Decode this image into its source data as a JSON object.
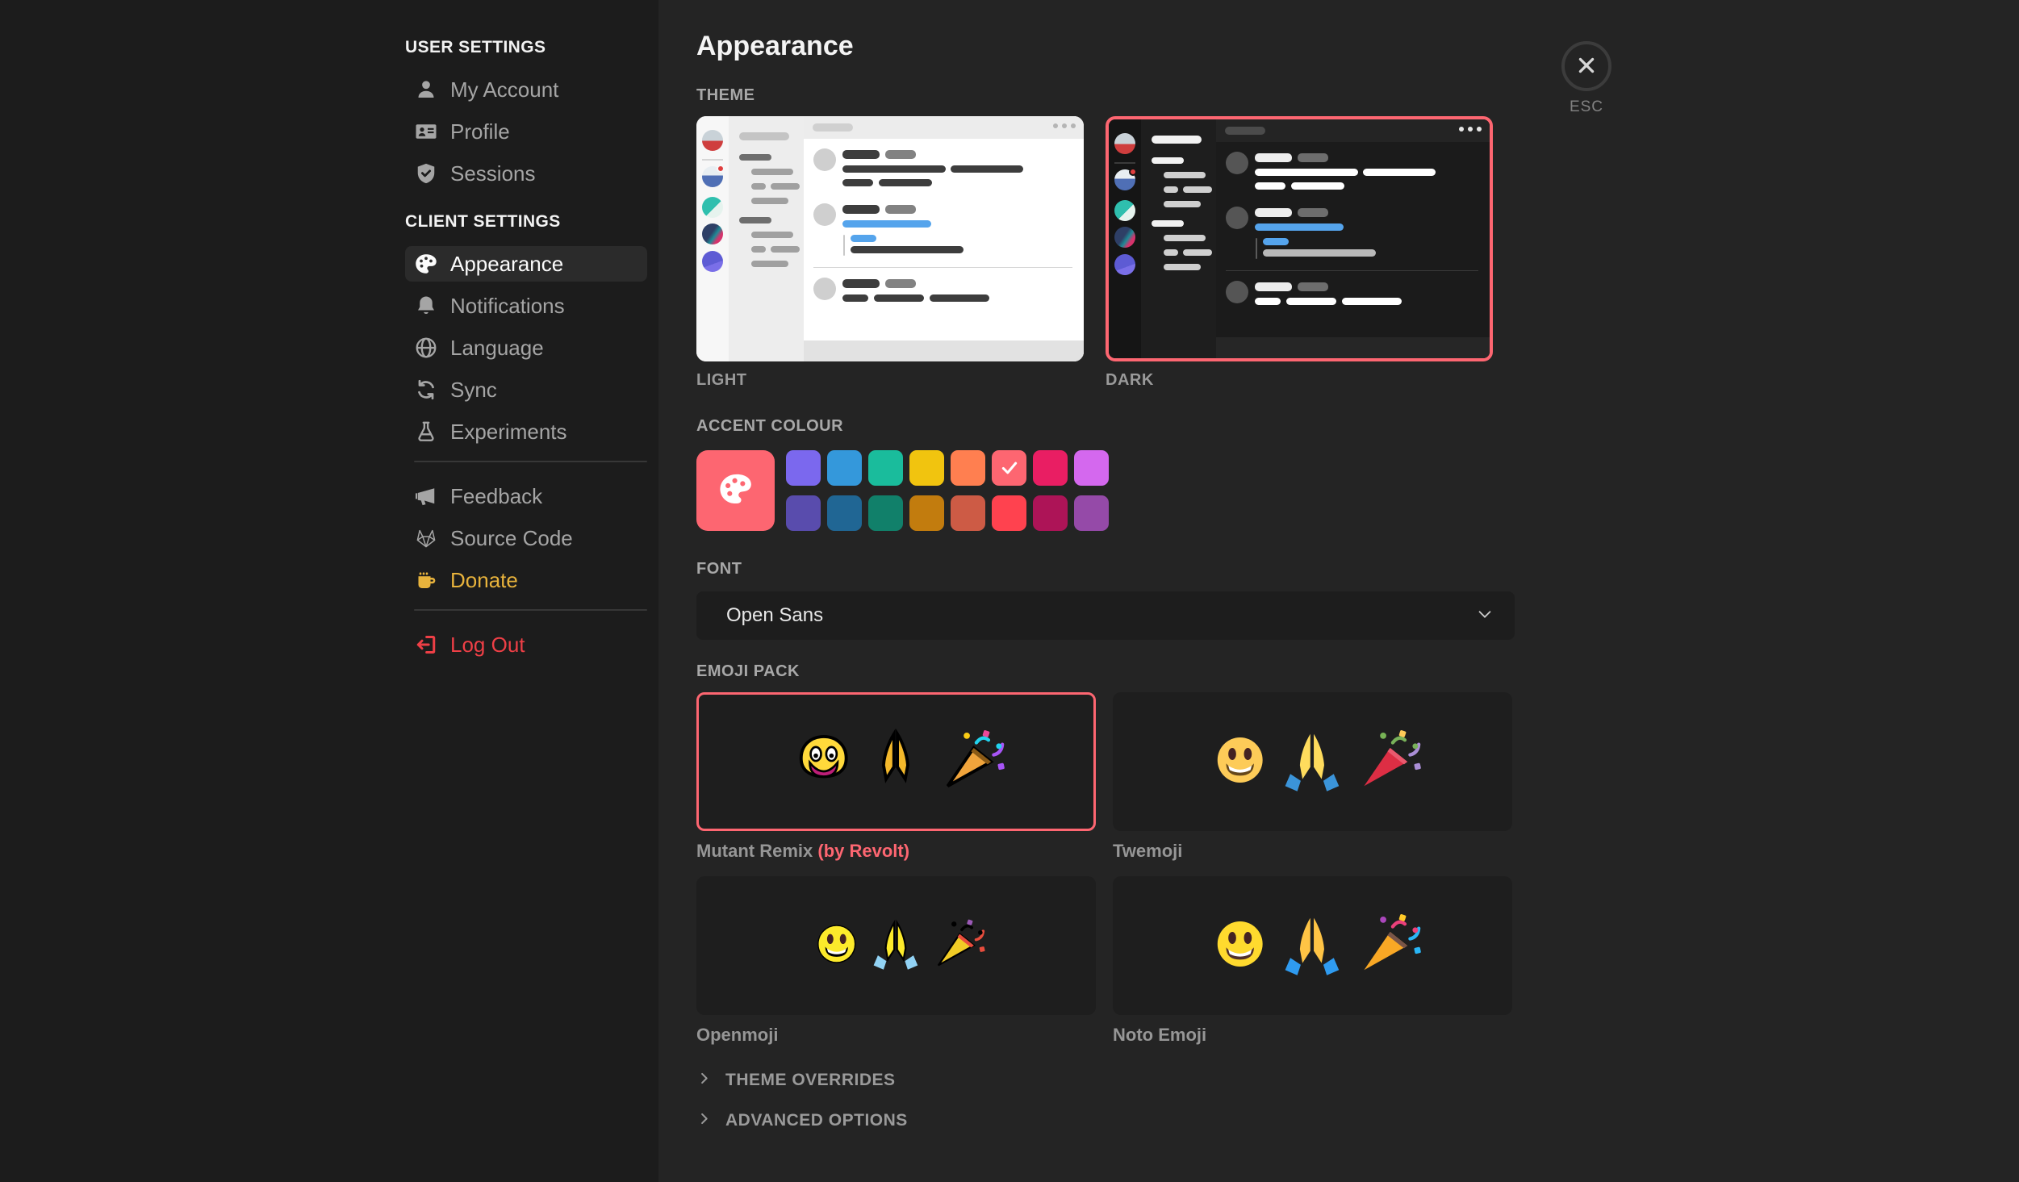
{
  "window": {
    "esc_label": "ESC"
  },
  "page": {
    "title": "Appearance"
  },
  "sidebar": {
    "sections": [
      {
        "title": "USER SETTINGS",
        "divider_above": false,
        "items": [
          {
            "label": "My Account",
            "icon": "person-icon"
          },
          {
            "label": "Profile",
            "icon": "id-card-icon"
          },
          {
            "label": "Sessions",
            "icon": "shield-icon"
          }
        ]
      },
      {
        "title": "CLIENT SETTINGS",
        "divider_above": false,
        "items": [
          {
            "label": "Appearance",
            "icon": "palette-icon",
            "active": true
          },
          {
            "label": "Notifications",
            "icon": "bell-icon"
          },
          {
            "label": "Language",
            "icon": "globe-icon"
          },
          {
            "label": "Sync",
            "icon": "sync-icon"
          },
          {
            "label": "Experiments",
            "icon": "flask-icon"
          }
        ]
      },
      {
        "title": "",
        "divider_above": true,
        "items": [
          {
            "label": "Feedback",
            "icon": "megaphone-icon"
          },
          {
            "label": "Source Code",
            "icon": "gitlab-icon"
          },
          {
            "label": "Donate",
            "icon": "mug-icon",
            "color": "#e8b33c"
          }
        ]
      },
      {
        "title": "",
        "divider_above": true,
        "items": [
          {
            "label": "Log Out",
            "icon": "logout-icon",
            "color": "#ee3f46"
          }
        ]
      }
    ]
  },
  "theme": {
    "label": "THEME",
    "options": [
      {
        "label": "LIGHT",
        "selected": false
      },
      {
        "label": "DARK",
        "selected": true
      }
    ]
  },
  "accent": {
    "label": "ACCENT COLOUR",
    "current_color": "#FD6671",
    "row1": [
      "#7B68EE",
      "#3498DB",
      "#1ABC9C",
      "#F1C40F",
      "#FF7F50",
      "#FD6671",
      "#E91E63",
      "#D468EE"
    ],
    "row2": [
      "#594CAD",
      "#206694",
      "#11806A",
      "#C27C0E",
      "#CD5B45",
      "#FF424F",
      "#AD1457",
      "#954AA8"
    ],
    "selected_row": 1,
    "selected_index": 5
  },
  "font": {
    "label": "FONT",
    "selected": "Open Sans"
  },
  "emoji": {
    "label": "EMOJI PACK",
    "packs": [
      {
        "name": "Mutant Remix",
        "byline": "(by Revolt)",
        "selected": true,
        "variant": "mutant"
      },
      {
        "name": "Twemoji",
        "byline": "",
        "selected": false,
        "variant": "twemoji"
      },
      {
        "name": "Openmoji",
        "byline": "",
        "selected": false,
        "variant": "openmoji"
      },
      {
        "name": "Noto Emoji",
        "byline": "",
        "selected": false,
        "variant": "noto"
      }
    ]
  },
  "collapsibles": [
    {
      "label": "THEME OVERRIDES"
    },
    {
      "label": "ADVANCED OPTIONS"
    }
  ],
  "colors": {
    "accent": "#FD6671",
    "sidebar_bg": "#1c1c1c",
    "content_bg": "#242424",
    "donate": "#e8b33c",
    "logout": "#ee3f46"
  }
}
